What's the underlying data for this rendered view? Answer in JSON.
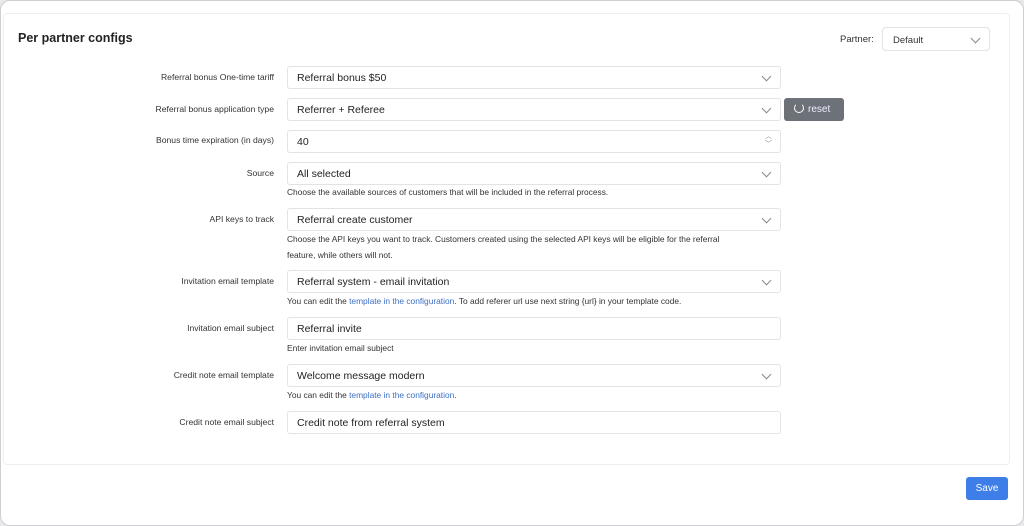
{
  "title": "Per partner configs",
  "partner": {
    "label": "Partner:",
    "value": "Default"
  },
  "fields": [
    {
      "label": "Referral bonus One-time tariff",
      "value": "Referral bonus $50",
      "type": "select"
    },
    {
      "label": "Referral bonus application type",
      "value": "Referrer + Referee",
      "type": "select"
    },
    {
      "label": "Bonus time expiration (in days)",
      "value": "40",
      "type": "number"
    },
    {
      "label": "Source",
      "value": "All selected",
      "type": "select",
      "help": "Choose the available sources of customers that will be included in the referral process."
    },
    {
      "label": "API keys to track",
      "value": "Referral create customer",
      "type": "select",
      "help1": "Choose the API keys you want to track. Customers created using the selected API keys will be eligible for the referral",
      "help2": "feature, while others will not."
    },
    {
      "label": "Invitation email template",
      "value": "Referral system - email invitation",
      "type": "select",
      "help_pre": "You can edit the ",
      "help_link": "template in the configuration",
      "help_post": ". To add referer url use next string {url} in your template code."
    },
    {
      "label": "Invitation email subject",
      "value": "Referral invite",
      "type": "text",
      "help": "Enter invitation email subject"
    },
    {
      "label": "Credit note email template",
      "value": "Welcome message modern",
      "type": "select",
      "help_pre": "You can edit the ",
      "help_link": "template in the configuration",
      "help_post": "."
    },
    {
      "label": "Credit note email subject",
      "value": "Credit note from referral system",
      "type": "text"
    }
  ],
  "reset_label": "reset",
  "save_label": "Save"
}
